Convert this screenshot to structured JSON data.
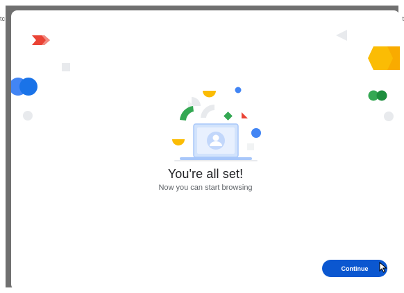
{
  "dialog": {
    "title": "You're all set!",
    "subtitle": "Now you can start browsing",
    "continue_label": "Continue"
  },
  "icons": {
    "avatar": "person-icon",
    "laptop": "laptop-icon",
    "cursor": "mouse-pointer-icon"
  },
  "colors": {
    "accent_blue": "#0b57d0",
    "google_blue": "#4285f4",
    "google_red": "#ea4335",
    "google_yellow": "#fbbc04",
    "google_green": "#34a853"
  }
}
